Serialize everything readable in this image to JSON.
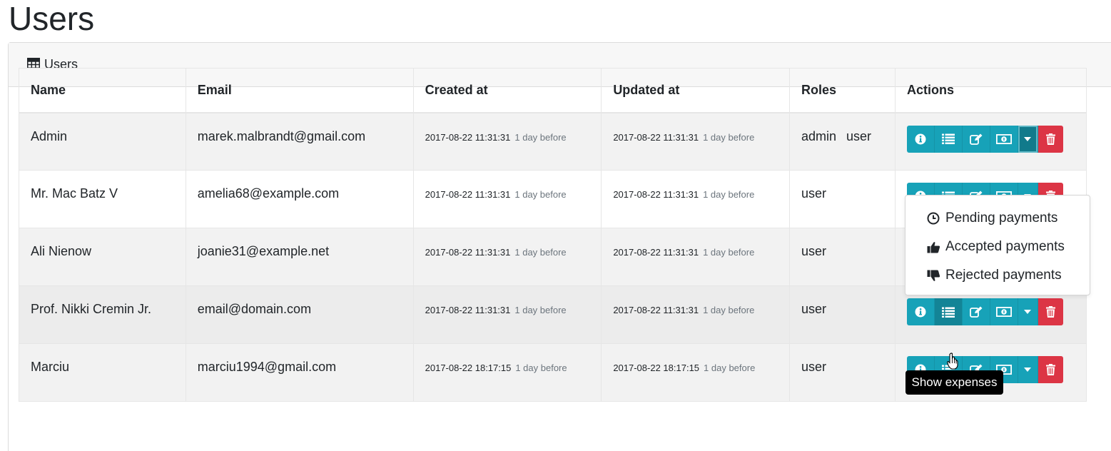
{
  "page": {
    "title": "Users"
  },
  "card": {
    "header_label": "Users"
  },
  "table": {
    "headers": [
      "Name",
      "Email",
      "Created at",
      "Updated at",
      "Roles",
      "Actions"
    ],
    "rows": [
      {
        "name": "Admin",
        "email": "marek.malbrandt@gmail.com",
        "created_date": "2017-08-22 11:31:31",
        "created_ago": "1 day before",
        "updated_date": "2017-08-22 11:31:31",
        "updated_ago": "1 day before",
        "role1": "admin",
        "role2": "user"
      },
      {
        "name": "Mr. Mac Batz V",
        "email": "amelia68@example.com",
        "created_date": "2017-08-22 11:31:31",
        "created_ago": "1 day before",
        "updated_date": "2017-08-22 11:31:31",
        "updated_ago": "1 day before",
        "role1": "user",
        "role2": ""
      },
      {
        "name": "Ali Nienow",
        "email": "joanie31@example.net",
        "created_date": "2017-08-22 11:31:31",
        "created_ago": "1 day before",
        "updated_date": "2017-08-22 11:31:31",
        "updated_ago": "1 day before",
        "role1": "user",
        "role2": ""
      },
      {
        "name": "Prof. Nikki Cremin Jr.",
        "email": "email@domain.com",
        "created_date": "2017-08-22 11:31:31",
        "created_ago": "1 day before",
        "updated_date": "2017-08-22 11:31:31",
        "updated_ago": "1 day before",
        "role1": "user",
        "role2": ""
      },
      {
        "name": "Marciu",
        "email": "marciu1994@gmail.com",
        "created_date": "2017-08-22 18:17:15",
        "created_ago": "1 day before",
        "updated_date": "2017-08-22 18:17:15",
        "updated_ago": "1 day before",
        "role1": "user",
        "role2": ""
      }
    ]
  },
  "actions": {
    "icons": [
      "info-icon",
      "list-icon",
      "edit-icon",
      "money-icon",
      "caret-down-icon",
      "trash-icon"
    ]
  },
  "dropdown": {
    "items": [
      {
        "label": "Pending payments",
        "icon": "clock-icon"
      },
      {
        "label": "Accepted payments",
        "icon": "thumbs-up-icon"
      },
      {
        "label": "Rejected payments",
        "icon": "thumbs-down-icon"
      }
    ]
  },
  "tooltip": {
    "text": "Show expenses"
  },
  "colors": {
    "info": "#17a2b8",
    "danger": "#dc3545",
    "tooltip_bg": "#000000"
  }
}
